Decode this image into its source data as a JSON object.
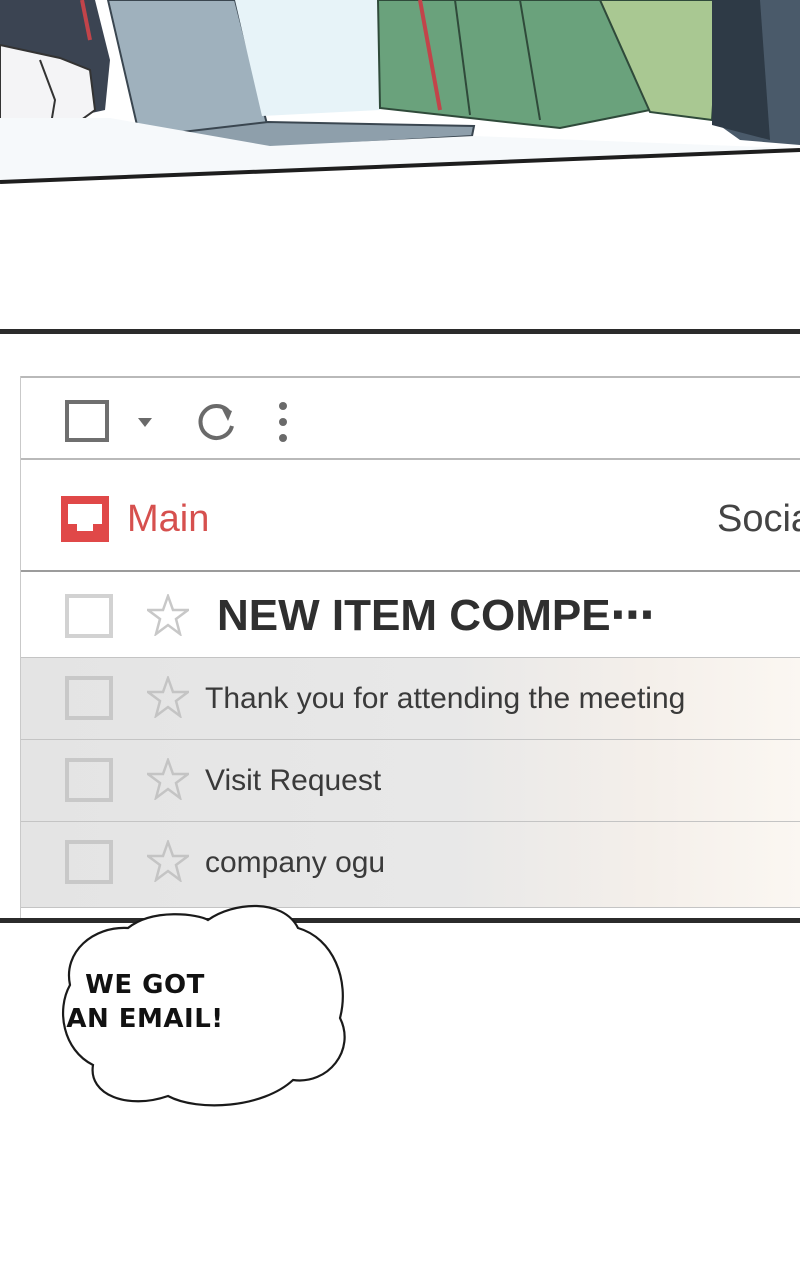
{
  "toolbar": {
    "select_all_icon": "checkbox-icon",
    "select_menu_icon": "caret-down-icon",
    "refresh_icon": "refresh-icon",
    "more_icon": "more-vertical-icon"
  },
  "tabs": {
    "main": {
      "label": "Main",
      "icon": "inbox-icon",
      "color": "#e04848"
    },
    "social": {
      "label": "Socia"
    }
  },
  "emails": [
    {
      "subject": "NEW ITEM COMPE⋯",
      "unread": true,
      "starred": false
    },
    {
      "subject": "Thank you for attending the meeting",
      "unread": false,
      "starred": false
    },
    {
      "subject": "Visit Request",
      "unread": false,
      "starred": false
    },
    {
      "subject": "company ogu",
      "unread": false,
      "starred": false
    }
  ],
  "speech_bubble": {
    "line1": "WE GOT",
    "line2": "AN EMAIL!"
  }
}
